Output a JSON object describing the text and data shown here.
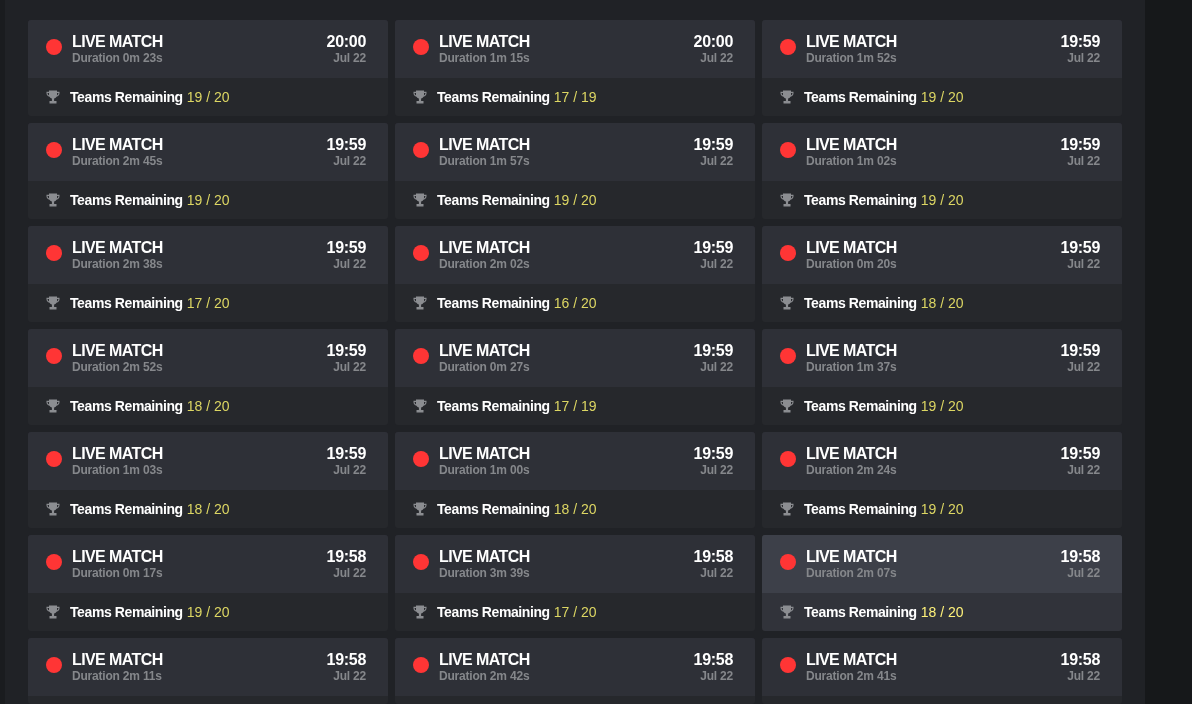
{
  "matches": [
    {
      "title": "LIVE MATCH",
      "duration": "Duration 0m 23s",
      "time": "20:00",
      "date": "Jul 22",
      "teams_label": "Teams Remaining",
      "teams_count": "19 / 20",
      "hovered": false
    },
    {
      "title": "LIVE MATCH",
      "duration": "Duration 1m 15s",
      "time": "20:00",
      "date": "Jul 22",
      "teams_label": "Teams Remaining",
      "teams_count": "17 / 19",
      "hovered": false
    },
    {
      "title": "LIVE MATCH",
      "duration": "Duration 1m 52s",
      "time": "19:59",
      "date": "Jul 22",
      "teams_label": "Teams Remaining",
      "teams_count": "19 / 20",
      "hovered": false
    },
    {
      "title": "LIVE MATCH",
      "duration": "Duration 2m 45s",
      "time": "19:59",
      "date": "Jul 22",
      "teams_label": "Teams Remaining",
      "teams_count": "19 / 20",
      "hovered": false
    },
    {
      "title": "LIVE MATCH",
      "duration": "Duration 1m 57s",
      "time": "19:59",
      "date": "Jul 22",
      "teams_label": "Teams Remaining",
      "teams_count": "19 / 20",
      "hovered": false
    },
    {
      "title": "LIVE MATCH",
      "duration": "Duration 1m 02s",
      "time": "19:59",
      "date": "Jul 22",
      "teams_label": "Teams Remaining",
      "teams_count": "19 / 20",
      "hovered": false
    },
    {
      "title": "LIVE MATCH",
      "duration": "Duration 2m 38s",
      "time": "19:59",
      "date": "Jul 22",
      "teams_label": "Teams Remaining",
      "teams_count": "17 / 20",
      "hovered": false
    },
    {
      "title": "LIVE MATCH",
      "duration": "Duration 2m 02s",
      "time": "19:59",
      "date": "Jul 22",
      "teams_label": "Teams Remaining",
      "teams_count": "16 / 20",
      "hovered": false
    },
    {
      "title": "LIVE MATCH",
      "duration": "Duration 0m 20s",
      "time": "19:59",
      "date": "Jul 22",
      "teams_label": "Teams Remaining",
      "teams_count": "18 / 20",
      "hovered": false
    },
    {
      "title": "LIVE MATCH",
      "duration": "Duration 2m 52s",
      "time": "19:59",
      "date": "Jul 22",
      "teams_label": "Teams Remaining",
      "teams_count": "18 / 20",
      "hovered": false
    },
    {
      "title": "LIVE MATCH",
      "duration": "Duration 0m 27s",
      "time": "19:59",
      "date": "Jul 22",
      "teams_label": "Teams Remaining",
      "teams_count": "17 / 19",
      "hovered": false
    },
    {
      "title": "LIVE MATCH",
      "duration": "Duration 1m 37s",
      "time": "19:59",
      "date": "Jul 22",
      "teams_label": "Teams Remaining",
      "teams_count": "19 / 20",
      "hovered": false
    },
    {
      "title": "LIVE MATCH",
      "duration": "Duration 1m 03s",
      "time": "19:59",
      "date": "Jul 22",
      "teams_label": "Teams Remaining",
      "teams_count": "18 / 20",
      "hovered": false
    },
    {
      "title": "LIVE MATCH",
      "duration": "Duration 1m 00s",
      "time": "19:59",
      "date": "Jul 22",
      "teams_label": "Teams Remaining",
      "teams_count": "18 / 20",
      "hovered": false
    },
    {
      "title": "LIVE MATCH",
      "duration": "Duration 2m 24s",
      "time": "19:59",
      "date": "Jul 22",
      "teams_label": "Teams Remaining",
      "teams_count": "19 / 20",
      "hovered": false
    },
    {
      "title": "LIVE MATCH",
      "duration": "Duration 0m 17s",
      "time": "19:58",
      "date": "Jul 22",
      "teams_label": "Teams Remaining",
      "teams_count": "19 / 20",
      "hovered": false
    },
    {
      "title": "LIVE MATCH",
      "duration": "Duration 3m 39s",
      "time": "19:58",
      "date": "Jul 22",
      "teams_label": "Teams Remaining",
      "teams_count": "17 / 20",
      "hovered": false
    },
    {
      "title": "LIVE MATCH",
      "duration": "Duration 2m 07s",
      "time": "19:58",
      "date": "Jul 22",
      "teams_label": "Teams Remaining",
      "teams_count": "18 / 20",
      "hovered": true
    },
    {
      "title": "LIVE MATCH",
      "duration": "Duration 2m 11s",
      "time": "19:58",
      "date": "Jul 22",
      "hovered": false
    },
    {
      "title": "LIVE MATCH",
      "duration": "Duration 2m 42s",
      "time": "19:58",
      "date": "Jul 22",
      "hovered": false
    },
    {
      "title": "LIVE MATCH",
      "duration": "Duration 2m 41s",
      "time": "19:58",
      "date": "Jul 22",
      "hovered": false
    }
  ]
}
